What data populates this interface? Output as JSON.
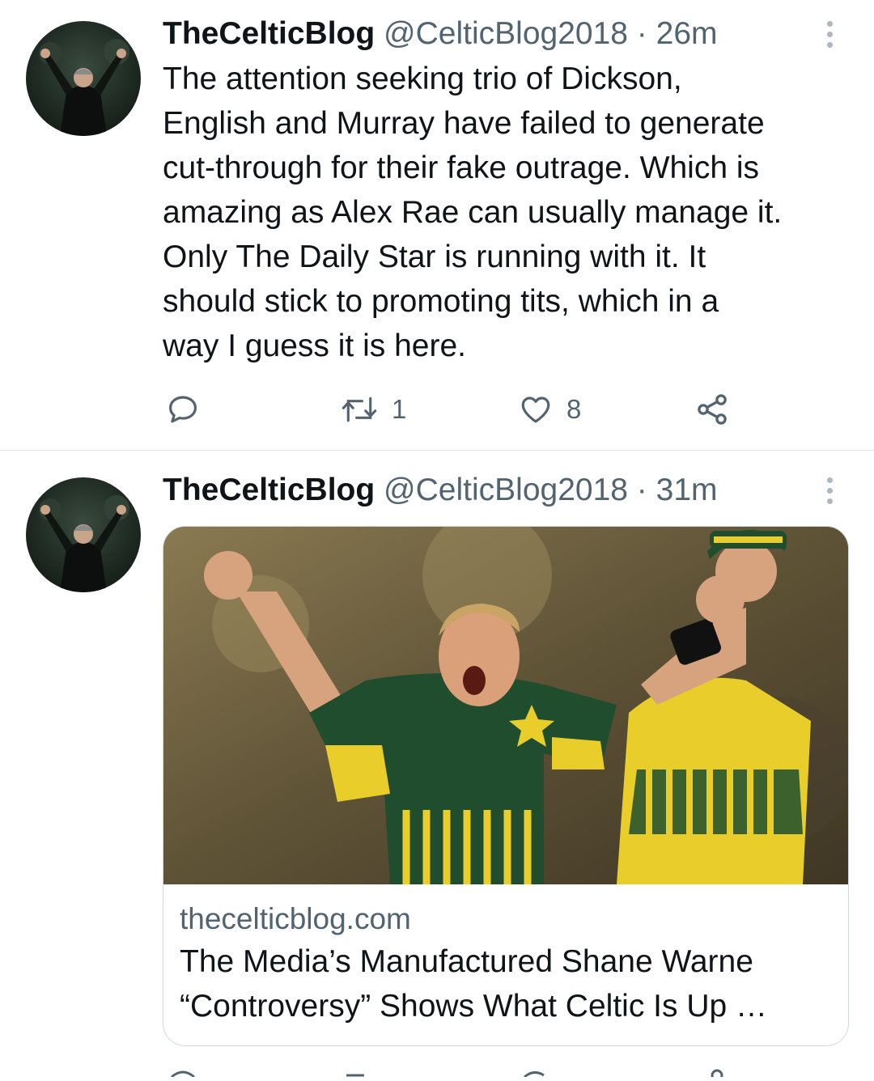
{
  "tweets": [
    {
      "name": "TheCelticBlog",
      "handle": "@CelticBlog2018",
      "time": "26m",
      "separator": " · ",
      "text": "The attention seeking trio of Dickson,\nEnglish and Murray have failed to generate\ncut-through for their fake outrage. Which is\namazing as Alex Rae can usually manage it.\nOnly The Daily Star is running with it. It\nshould stick to promoting tits, which in a\nway I guess it is here.",
      "actions": {
        "reply_icon": "reply-icon",
        "retweet_icon": "retweet-icon",
        "retweets": "1",
        "like_icon": "heart-icon",
        "likes": "8",
        "share_icon": "share-icon"
      }
    },
    {
      "name": "TheCelticBlog",
      "handle": "@CelticBlog2018",
      "time": "31m",
      "separator": " · ",
      "card": {
        "domain": "thecelticblog.com",
        "title_line1": "The Media’s Manufactured Shane Warne",
        "title_line2": "“Controversy” Shows What Celtic Is Up …"
      }
    }
  ],
  "colors": {
    "text": "#0f1419",
    "secondary": "#536471",
    "divider": "#e1e8ed",
    "card_border": "#cfd9de"
  }
}
